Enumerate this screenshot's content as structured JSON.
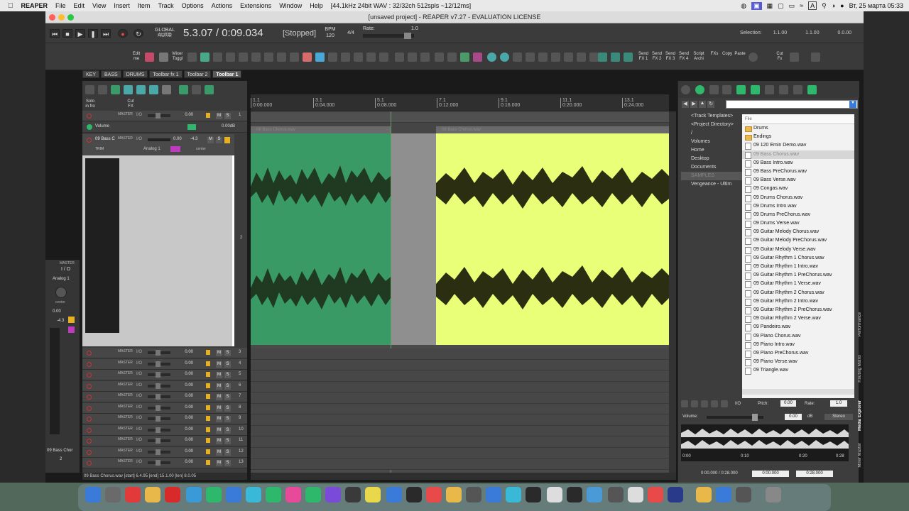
{
  "menubar": {
    "apple": "",
    "app_name": "REAPER",
    "items": [
      "File",
      "Edit",
      "View",
      "Insert",
      "Item",
      "Track",
      "Options",
      "Actions",
      "Extensions",
      "Window",
      "Help"
    ],
    "status": "[44.1kHz 24bit WAV : 32/32ch 512spls ~12/12ms]",
    "lang": "A",
    "datetime": "Вт, 25 марта  05:33"
  },
  "window": {
    "title": "[unsaved project] - REAPER v7.27 - EVALUATION LICENSE"
  },
  "transport": {
    "time": "5.3.07 / 0:09.034",
    "state": "[Stopped]",
    "bpm_label": "BPM",
    "bpm": "120",
    "timesig": "4/4",
    "global_auto": "GLOBAL AUTO",
    "auto_state": "NONE",
    "rate_label": "Rate:",
    "rate_value": "1.0",
    "selection_label": "Selection:",
    "sel_start": "1.1.00",
    "sel_end": "1.1.00",
    "sel_len": "0.0.00"
  },
  "toolbar": {
    "edit_label": "Edit me",
    "mixer_label": "Mixer Toggl",
    "send_labels": [
      "Send FX 1",
      "Send FX 2",
      "Send FX 3",
      "Send FX 4"
    ],
    "script_label": "Script Archi",
    "fxs_label": "FXs",
    "copy_label": "Copy",
    "paste_label": "Paste",
    "cut_label": "Cut Fx",
    "solo_label": "Solo in fro",
    "cutfx_label": "Cut FX"
  },
  "tabs": [
    "KEY",
    "BASS",
    "DRUMS",
    "Toolbar fx 1",
    "Toolbar 2",
    "Toolbar 1"
  ],
  "tcp": {
    "master_label": "MASTER",
    "io_label": "I/O",
    "master_vol": "0.00",
    "envelope_label": "Volume",
    "envelope_value": "0.00dB",
    "track_name": "09 Bass C",
    "track_vol": "0.00",
    "track_pan": "-4.3",
    "trim_label": "TRIM",
    "input_label": "Analog 1",
    "center_label": "center",
    "m": "M",
    "s": "S",
    "empty_vol": "0.00",
    "track_numbers": [
      "1",
      "2",
      "3",
      "4",
      "5",
      "6",
      "7",
      "8",
      "9",
      "10",
      "11",
      "12",
      "13"
    ]
  },
  "mcp": {
    "master": "MASTER",
    "io": "I / O",
    "input": "Analog 1",
    "center": "center",
    "vol": "0.00",
    "db": "-4.3",
    "name": "09 Bass Chor",
    "num": "2"
  },
  "ruler": {
    "marks": [
      "1.1",
      "3.1",
      "5.1",
      "7.1",
      "9.1",
      "11.1",
      "13.1"
    ],
    "times": [
      "0:00.000",
      "0:04.000",
      "0:08.000",
      "0:12.000",
      "0:16.000",
      "0:20.000",
      "0:24.000"
    ]
  },
  "items": {
    "a_name": "09 Bass Chorus.wav",
    "b_name": "09 Bass Chorus.wav"
  },
  "status_line": "09 Bass Chorus.wav [start] 6.4.95 [end] 15.1.00 [len] 8.0.05",
  "media_explorer": {
    "tree": [
      "<Track Templates>",
      "<Project Directory>",
      "/",
      "Volumes",
      "Home",
      "Desktop",
      "Documents",
      "SAMPLES",
      "Vengeance - Ultim"
    ],
    "list_header": "File",
    "folders": [
      "Drums",
      "Endings"
    ],
    "files": [
      "09 120 Emin Demo.wav",
      "09 Bass Chorus.wav",
      "09 Bass Intro.wav",
      "09 Bass PreChorus.wav",
      "09 Bass Verse.wav",
      "09 Congas.wav",
      "09 Drums Chorus.wav",
      "09 Drums Intro.wav",
      "09 Drums PreChorus.wav",
      "09 Drums Verse.wav",
      "09 Guitar Melody Chorus.wav",
      "09 Guitar Melody PreChorus.wav",
      "09 Guitar Melody Verse.wav",
      "09 Guitar Rhythm 1 Chorus.wav",
      "09 Guitar Rhythm 1 Intro.wav",
      "09 Guitar Rhythm 1 PreChorus.wav",
      "09 Guitar Rhythm 1 Verse.wav",
      "09 Guitar Rhythm 2 Chorus.wav",
      "09 Guitar Rhythm 2 Intro.wav",
      "09 Guitar Rhythm 2 PreChorus.wav",
      "09 Guitar Rhythm 2 Verse.wav",
      "09 Pandeiro.wav",
      "09 Piano Chorus.wav",
      "09 Piano Intro.wav",
      "09 Piano PreChorus.wav",
      "09 Piano Verse.wav",
      "09 Triangle.wav"
    ],
    "io_label": "I/O",
    "pitch_label": "Pitch:",
    "pitch_value": "0.00",
    "rate_label": "Rate:",
    "rate_value": "1.0",
    "volume_label": "Volume:",
    "volume_value": "0.00",
    "db_label": "dB",
    "stereo_label": "Stereo",
    "wave_times": [
      "0:00",
      "0:10",
      "0:20",
      "0:28"
    ],
    "time_readout": "0:00.000 / 0:28.000",
    "time_start": "0:00.000",
    "time_end": "0:28.000",
    "side_tabs": [
      "Performance",
      "Routing Matrix",
      "Media Explorer",
      "Mixer Master"
    ]
  },
  "colors": {
    "item_a": "#3a9a66",
    "item_b": "#eaff78",
    "waveform": "#1f3a20",
    "accent_green": "#2db86b"
  }
}
